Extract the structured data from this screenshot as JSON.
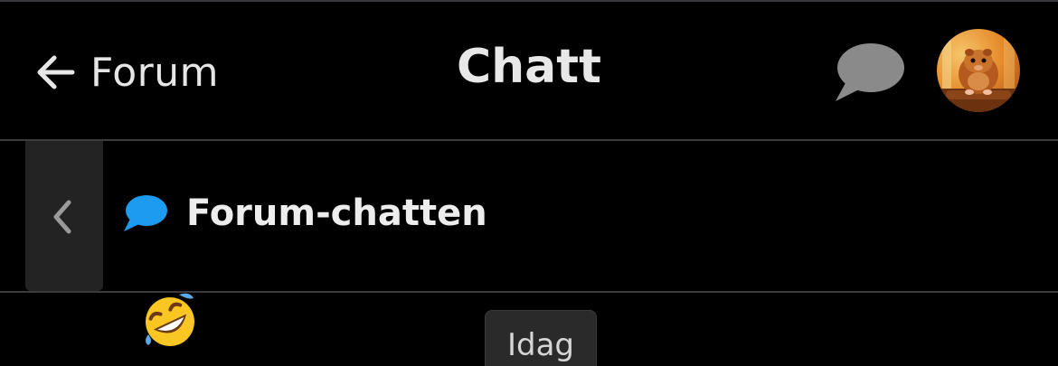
{
  "header": {
    "back_label": "Forum",
    "title": "Chatt",
    "chat_icon": "speech-bubble-icon",
    "avatar_icon": "guinea-pig-avatar"
  },
  "channel": {
    "icon": "speech-bubble-icon",
    "icon_color": "#1d9bf0",
    "name": "Forum-chatten"
  },
  "messages": {
    "first_reaction_icon": "rolling-on-floor-laughing-emoji",
    "date_separator": "Idag"
  },
  "colors": {
    "background": "#000000",
    "divider": "#3b3b3b",
    "muted_icon": "#8a8a8a",
    "accent": "#1d9bf0"
  }
}
